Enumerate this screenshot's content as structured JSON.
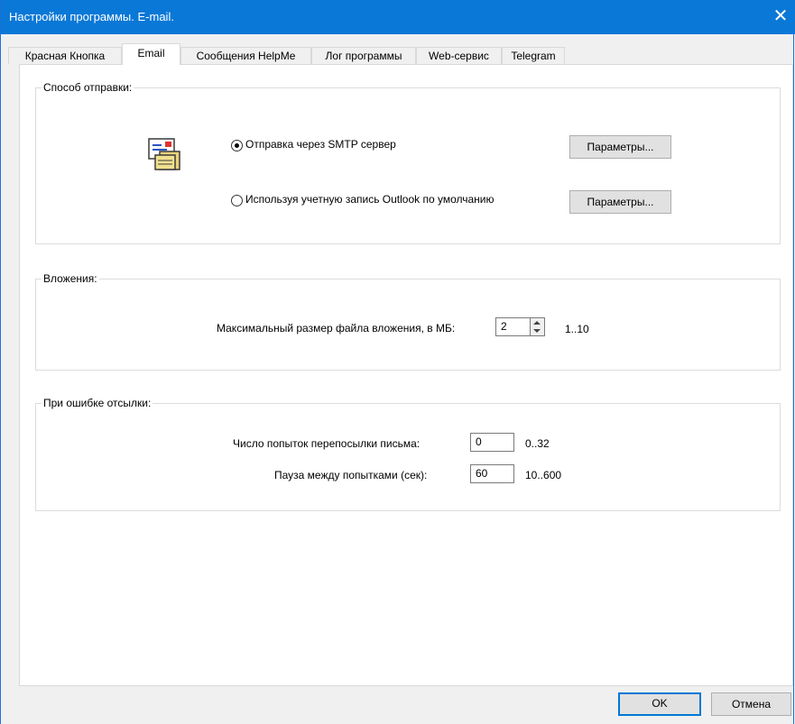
{
  "window": {
    "title": "Настройки программы. E-mail.",
    "close_glyph": "✕"
  },
  "tabs": [
    {
      "label": "Красная Кнопка",
      "active": false
    },
    {
      "label": "Email",
      "active": true
    },
    {
      "label": "Сообщения HelpMe",
      "active": false
    },
    {
      "label": "Лог программы",
      "active": false
    },
    {
      "label": "Web-сервис",
      "active": false
    },
    {
      "label": "Telegram",
      "active": false
    }
  ],
  "send_method": {
    "legend": "Способ отправки:",
    "icon": "mail-icon",
    "smtp": {
      "label": "Отправка через SMTP сервер",
      "selected": true,
      "params_label": "Параметры..."
    },
    "outlook": {
      "label": "Используя учетную запись Outlook по умолчанию",
      "selected": false,
      "params_label": "Параметры..."
    }
  },
  "attachments": {
    "legend": "Вложения:",
    "max_size_label": "Максимальный размер файла вложения, в МБ:",
    "max_size_value": "2",
    "range": "1..10"
  },
  "on_error": {
    "legend": "При ошибке отсылки:",
    "retries_label": "Число попыток перепосылки письма:",
    "retries_value": "0",
    "retries_range": "0..32",
    "pause_label": "Пауза между попытками (сек):",
    "pause_value": "60",
    "pause_range": "10..600"
  },
  "footer": {
    "ok_label": "OK",
    "cancel_label": "Отмена"
  },
  "colors": {
    "titlebar": "#0a78d7",
    "accent": "#0078d7"
  }
}
